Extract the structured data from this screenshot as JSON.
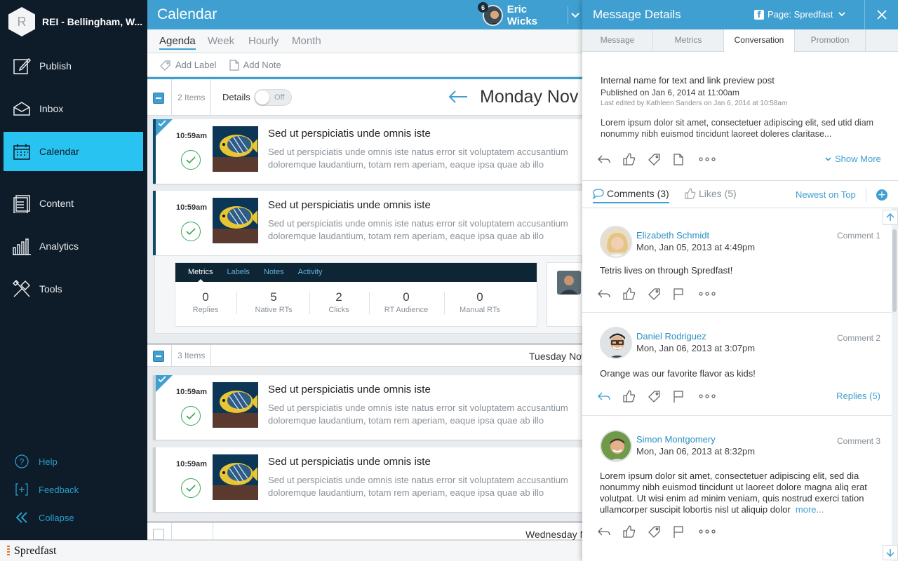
{
  "sidebar": {
    "org_initial": "R",
    "org_name": "REI - Bellingham, W...",
    "nav": [
      {
        "label": "Publish",
        "icon": "publish-icon"
      },
      {
        "label": "Inbox",
        "icon": "inbox-icon"
      },
      {
        "label": "Calendar",
        "icon": "calendar-icon",
        "active": true
      },
      {
        "label": "Content",
        "icon": "content-icon"
      },
      {
        "label": "Analytics",
        "icon": "analytics-icon"
      },
      {
        "label": "Tools",
        "icon": "tools-icon"
      }
    ],
    "utility": [
      {
        "label": "Help",
        "icon": "help-icon"
      },
      {
        "label": "Feedback",
        "icon": "feedback-icon"
      },
      {
        "label": "Collapse",
        "icon": "collapse-icon"
      }
    ]
  },
  "header": {
    "title": "Calendar",
    "user_name": "Eric Wicks",
    "notification_count": "6"
  },
  "view_tabs": [
    "Agenda",
    "Week",
    "Hourly",
    "Month"
  ],
  "actions": {
    "add_label": "Add Label",
    "add_note": "Add Note"
  },
  "day1": {
    "count": "2 Items",
    "details_label": "Details",
    "toggle_state": "Off",
    "title": "Monday Nov"
  },
  "day2": {
    "count": "3 Items",
    "title": "Tuesday Nov"
  },
  "day3": {
    "title": "Wednesday N"
  },
  "posts": [
    {
      "time": "10:59am",
      "title": "Sed ut perspiciatis unde omnis iste",
      "body": "Sed ut perspiciatis unde omnis iste natus error sit voluptatem accusantium doloremque laudantium, totam rem aperiam, eaque ipsa quae ab illo"
    },
    {
      "time": "10:59am",
      "title": "Sed ut perspiciatis unde omnis iste",
      "body": "Sed ut perspiciatis unde omnis iste natus error sit voluptatem accusantium doloremque laudantium, totam rem aperiam, eaque ipsa quae ab illo"
    },
    {
      "time": "10:59am",
      "title": "Sed ut perspiciatis unde omnis iste",
      "body": "Sed ut perspiciatis unde omnis iste natus error sit voluptatem accusantium doloremque laudantium, totam rem aperiam, eaque ipsa quae ab illo"
    },
    {
      "time": "10:59am",
      "title": "Sed ut perspiciatis unde omnis iste",
      "body": "Sed ut perspiciatis unde omnis iste natus error sit voluptatem accusantium doloremque laudantium, totam rem aperiam, eaque ipsa quae ab illo"
    }
  ],
  "metrics": {
    "tabs": [
      "Metrics",
      "Labels",
      "Notes",
      "Activity"
    ],
    "stats": [
      {
        "value": "0",
        "label": "Replies"
      },
      {
        "value": "5",
        "label": "Native RTs"
      },
      {
        "value": "2",
        "label": "Clicks"
      },
      {
        "value": "0",
        "label": "RT Audience"
      },
      {
        "value": "0",
        "label": "Manual RTs"
      }
    ]
  },
  "details": {
    "title": "Message Details",
    "page_label": "Page: Spredfast",
    "tabs": [
      "Message",
      "Metrics",
      "Conversation",
      "Promotion"
    ],
    "message": {
      "name": "Internal name for text and link preview post",
      "published": "Published on Jan 6, 2014 at 11:00am",
      "edited": "Last edited by Kathleen Sanders on Jan 6, 2014 at 10:58am",
      "text": "Lorem ipsum dolor sit amet, consectetuer adipiscing elit, sed utid diam nonummy nibh euismod tincidunt laoreet doleres claritase...",
      "show_more": "Show More"
    },
    "comments_tab": "Comments (3)",
    "likes_tab": "Likes (5)",
    "sort_label": "Newest on Top",
    "comments": [
      {
        "author": "Elizabeth Schmidt",
        "date": "Mon, Jan 05, 2013 at 4:49pm",
        "label": "Comment 1",
        "text": "Tetris lives on through Spredfast!"
      },
      {
        "author": "Daniel Rodriguez",
        "date": "Mon, Jan 06, 2013 at 3:07pm",
        "label": "Comment 2",
        "text": "Orange was our favorite flavor as kids!",
        "replies": "Replies (5)"
      },
      {
        "author": "Simon Montgomery",
        "date": "Mon, Jan 06, 2013 at 8:32pm",
        "label": "Comment 3",
        "text": "Lorem ipsum dolor sit amet, consectetuer adipiscing elit, sed dia nonummy nibh euismod tincidunt ut laoreet dolore magna aliq erat volutpat. Ut wisi enim ad minim veniam, quis nostrud exerci tation ullamcorper suscipit lobortis nisl ut aliquip dolor",
        "more": "more..."
      }
    ]
  },
  "footer": {
    "brand": "Spredfast"
  },
  "colors": {
    "accent": "#3f9fd0",
    "active_nav": "#29c3f1",
    "sidebar": "#0e1b28",
    "success": "#3aa655"
  }
}
